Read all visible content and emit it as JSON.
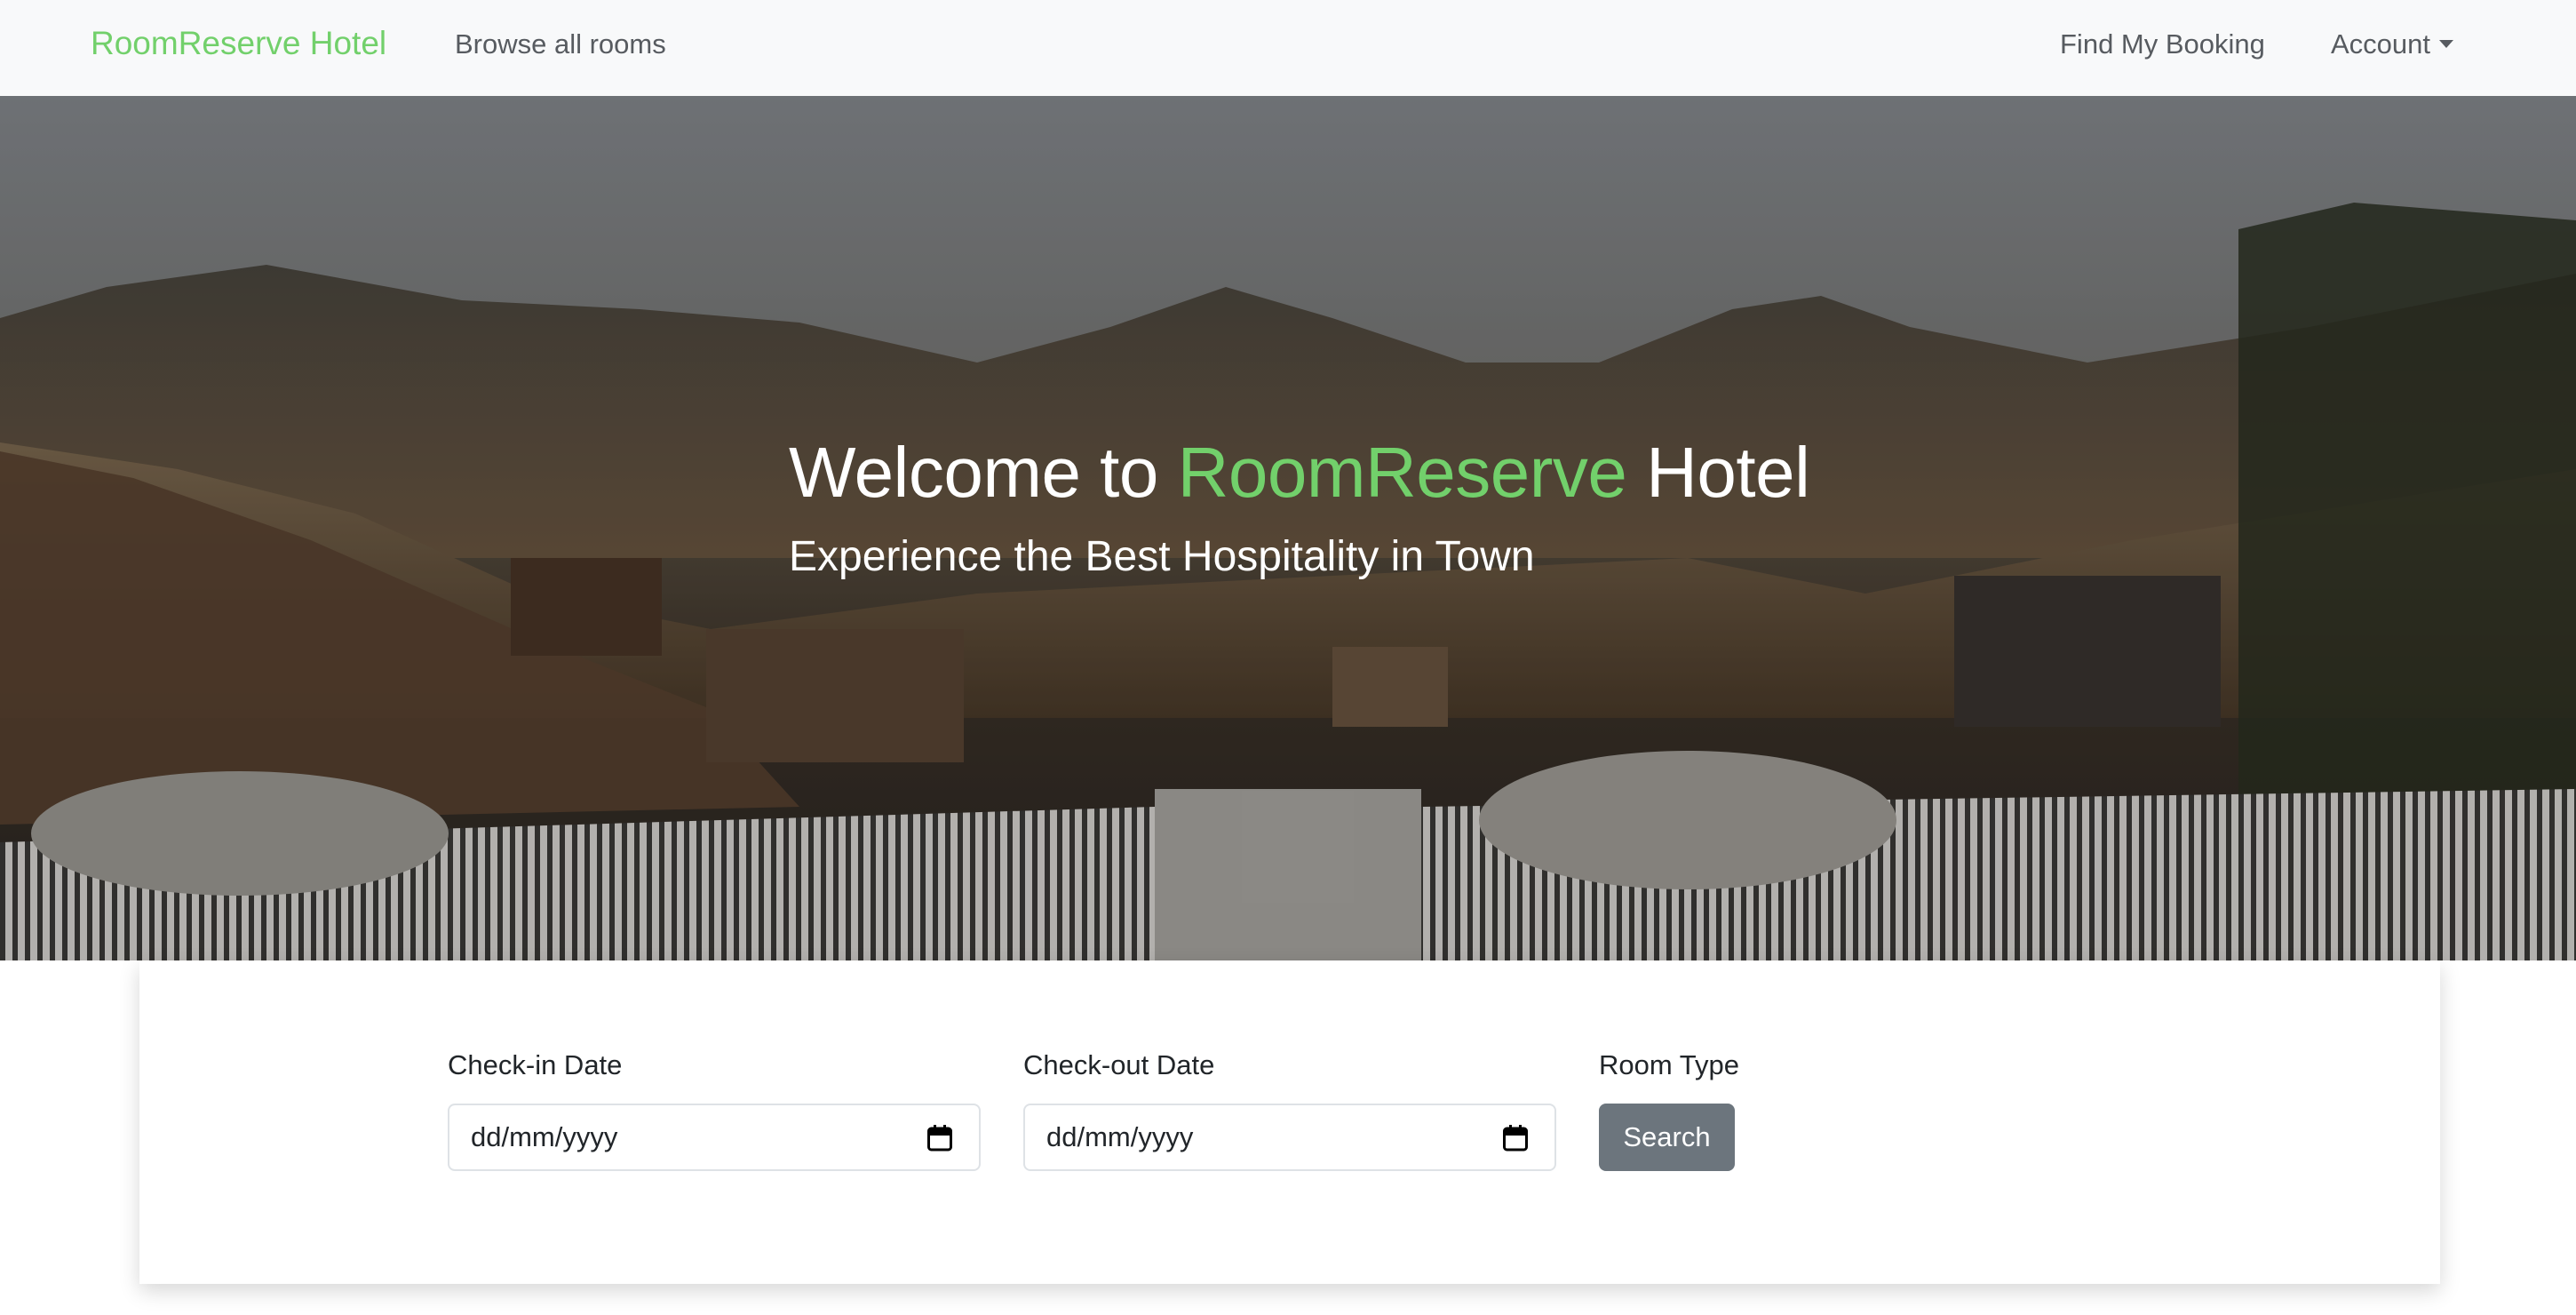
{
  "navbar": {
    "brand": "RoomReserve Hotel",
    "browse_label": "Browse all rooms",
    "find_booking_label": "Find My Booking",
    "account_label": "Account"
  },
  "hero": {
    "title_prefix": "Welcome to ",
    "title_accent": "RoomReserve",
    "title_suffix": " Hotel",
    "subtitle": "Experience the Best Hospitality in Town"
  },
  "search": {
    "checkin_label": "Check-in Date",
    "checkin_value": "dd/mm/yyyy",
    "checkout_label": "Check-out Date",
    "checkout_value": "dd/mm/yyyy",
    "room_type_label": "Room Type",
    "search_button": "Search"
  },
  "colors": {
    "accent": "#72d06b",
    "navbar_bg": "#f8f9fa",
    "button_bg": "#6c757d"
  },
  "icons": {
    "calendar": "calendar-icon",
    "account_dropdown": "caret-down-icon"
  }
}
